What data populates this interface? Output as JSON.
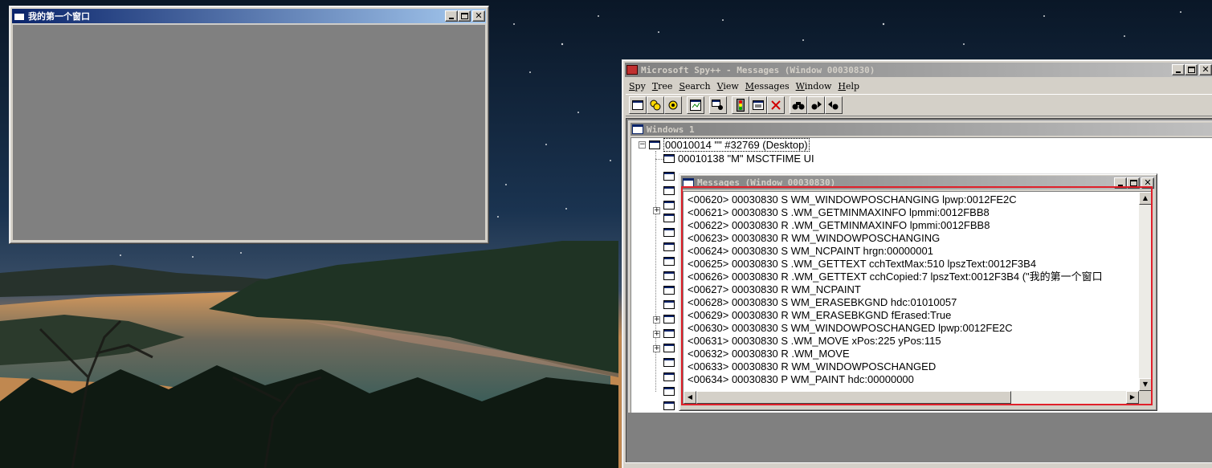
{
  "desktop": {
    "wallpaper": "starry night over lake with forested hills"
  },
  "window1": {
    "title": "我的第一个窗口"
  },
  "spy": {
    "title": "Microsoft Spy++ - Messages (Window 00030830)",
    "menu": [
      {
        "label": "Spy",
        "key": "S",
        "rest": "py"
      },
      {
        "label": "Tree",
        "key": "T",
        "rest": "ree"
      },
      {
        "label": "Search",
        "key": "S",
        "rest": "earch"
      },
      {
        "label": "View",
        "key": "V",
        "rest": "iew"
      },
      {
        "label": "Messages",
        "key": "M",
        "rest": "essages"
      },
      {
        "label": "Window",
        "key": "W",
        "rest": "indow"
      },
      {
        "label": "Help",
        "key": "H",
        "rest": "elp"
      }
    ],
    "toolbar_icons": [
      "windows-icon",
      "processes-icon",
      "threads-icon",
      "messages-icon",
      "find-window-icon",
      "start-logging-icon",
      "message-options-icon",
      "clear-icon",
      "find-icon",
      "find-next-icon",
      "find-previous-icon"
    ],
    "tree": {
      "title": "Windows 1",
      "root": "00010014 \"\" #32769 (Desktop)",
      "child1": "00010138 \"M\" MSCTFIME UI"
    },
    "messages": {
      "title": "Messages (Window 00030830)",
      "lines": [
        "<00620> 00030830 S WM_WINDOWPOSCHANGING lpwp:0012FE2C",
        "<00621> 00030830 S .WM_GETMINMAXINFO lpmmi:0012FBB8",
        "<00622> 00030830 R .WM_GETMINMAXINFO lpmmi:0012FBB8",
        "<00623> 00030830 R WM_WINDOWPOSCHANGING",
        "<00624> 00030830 S WM_NCPAINT hrgn:00000001",
        "<00625> 00030830 S .WM_GETTEXT cchTextMax:510 lpszText:0012F3B4",
        "<00626> 00030830 R .WM_GETTEXT cchCopied:7 lpszText:0012F3B4 (\"我的第一个窗口",
        "<00627> 00030830 R WM_NCPAINT",
        "<00628> 00030830 S WM_ERASEBKGND hdc:01010057",
        "<00629> 00030830 R WM_ERASEBKGND fErased:True",
        "<00630> 00030830 S WM_WINDOWPOSCHANGED lpwp:0012FE2C",
        "<00631> 00030830 S .WM_MOVE xPos:225 yPos:115",
        "<00632> 00030830 R .WM_MOVE",
        "<00633> 00030830 R WM_WINDOWPOSCHANGED",
        "<00634> 00030830 P WM_PAINT hdc:00000000"
      ]
    }
  },
  "colors": {
    "active_title": "#0a246a",
    "highlight_box": "#e0202a",
    "window_face": "#d4d0c8"
  }
}
